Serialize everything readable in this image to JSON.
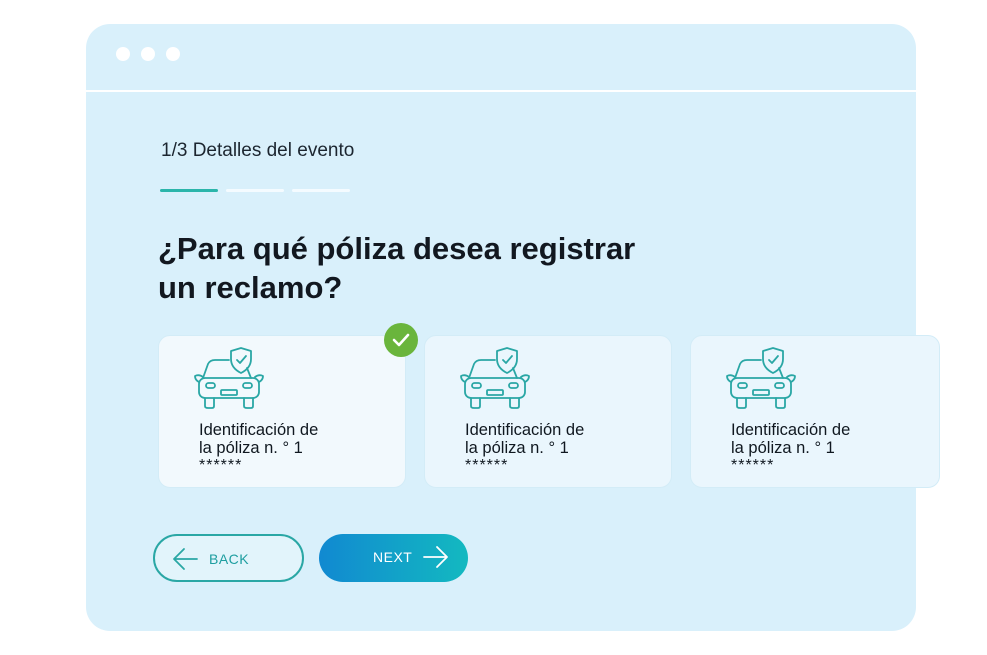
{
  "window": {
    "step_label": "1/3 Detalles del evento",
    "progress": {
      "current_step": 1,
      "total_steps": 3
    },
    "question": "¿Para qué póliza desea registrar un reclamo?"
  },
  "policies": [
    {
      "line1": "Identificación de",
      "line2": "la póliza n. ° 1",
      "masked": "******",
      "selected": true
    },
    {
      "line1": "Identificación de",
      "line2": "la póliza n. ° 1",
      "masked": "******",
      "selected": false
    },
    {
      "line1": "Identificación de",
      "line2": "la póliza n. ° 1",
      "masked": "******",
      "selected": false
    }
  ],
  "buttons": {
    "back_label": "BACK",
    "next_label": "NEXT"
  },
  "icons": {
    "card_icon": "car-shield-icon",
    "selected_icon": "check-icon",
    "back_icon": "arrow-left-icon",
    "next_icon": "arrow-right-icon"
  },
  "colors": {
    "accent": "#2bb5aa",
    "selected_badge": "#6ab53c",
    "next_gradient_start": "#1189d1",
    "next_gradient_end": "#13b9c0",
    "window_bg": "#d9f0fb"
  }
}
